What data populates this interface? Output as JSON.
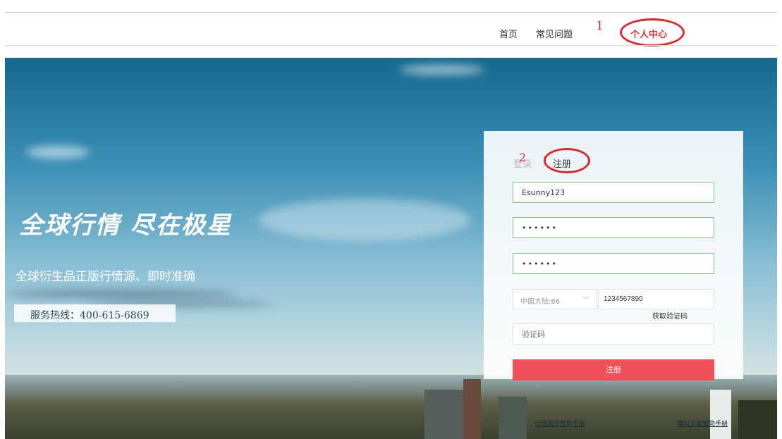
{
  "nav": {
    "home": "首页",
    "faq": "常见问题",
    "personal_center": "个人中心",
    "step1": "1"
  },
  "hero": {
    "slogan": "全球行情 尽在极星",
    "tagline": "全球衍生品正版行情源、即时准确",
    "hotline": "服务热线：400-615-6869"
  },
  "panel": {
    "tab_login": "登录",
    "tab_separator": "|",
    "tab_register": "注册",
    "step2": "2",
    "username_value": "Esunny123",
    "password_value": "••••••",
    "confirm_password_value": "••••••",
    "region_value": "中国大陆:86",
    "phone_value": "1234567890",
    "get_code": "获取验证码",
    "code_placeholder": "验证码",
    "submit": "注册"
  },
  "footer": {
    "link_quote_help": "行情购买帮助手册",
    "link_sim_help": "模拟交易帮助手册"
  },
  "colors": {
    "accent_red": "#e3262c",
    "button_red": "#ee5258",
    "field_border_green": "#7fc07f"
  }
}
